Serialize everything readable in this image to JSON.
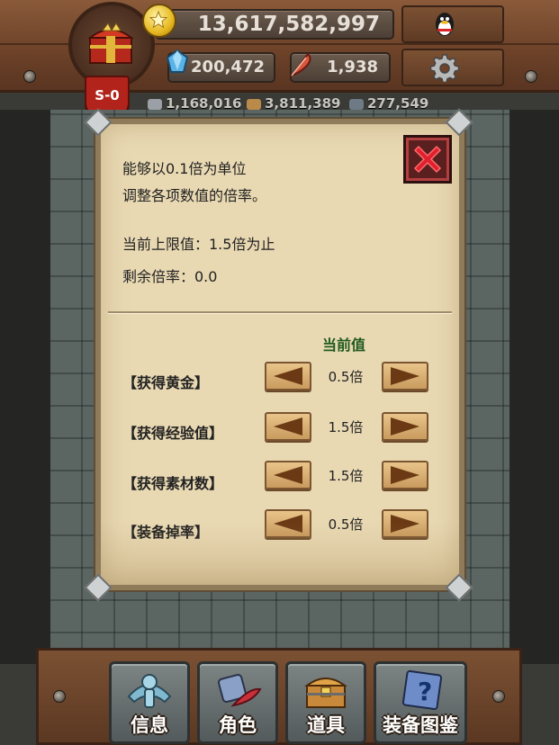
{
  "hud": {
    "season": "S-0",
    "gold": "13,617,582,997",
    "gems": "200,472",
    "feathers": "1,938",
    "materials": [
      "1,168,016",
      "3,811,389",
      "277,549"
    ]
  },
  "dialog": {
    "line1": "能够以0.1倍为单位",
    "line2": "调整各项数值的倍率。",
    "limit": "当前上限值：1.5倍为止",
    "remaining": "剩余倍率：0.0",
    "column_header": "当前值",
    "rows": [
      {
        "label": "【获得黄金】",
        "value": "0.5倍"
      },
      {
        "label": "【获得经验值】",
        "value": "1.5倍"
      },
      {
        "label": "【获得素材数】",
        "value": "1.5倍"
      },
      {
        "label": "【装备掉率】",
        "value": "0.5倍"
      }
    ]
  },
  "menu": {
    "items": [
      {
        "label": "信息",
        "icon": "info-icon"
      },
      {
        "label": "角色",
        "icon": "character-icon"
      },
      {
        "label": "道具",
        "icon": "item-chest-icon"
      },
      {
        "label": "装备图鉴",
        "icon": "equipment-book-icon"
      }
    ]
  },
  "colors": {
    "wood": "#6e4329",
    "parchment": "#e9d9b3",
    "accent_green": "#1f5a1f",
    "close_red": "#e0202e",
    "season_red": "#b2241b"
  }
}
